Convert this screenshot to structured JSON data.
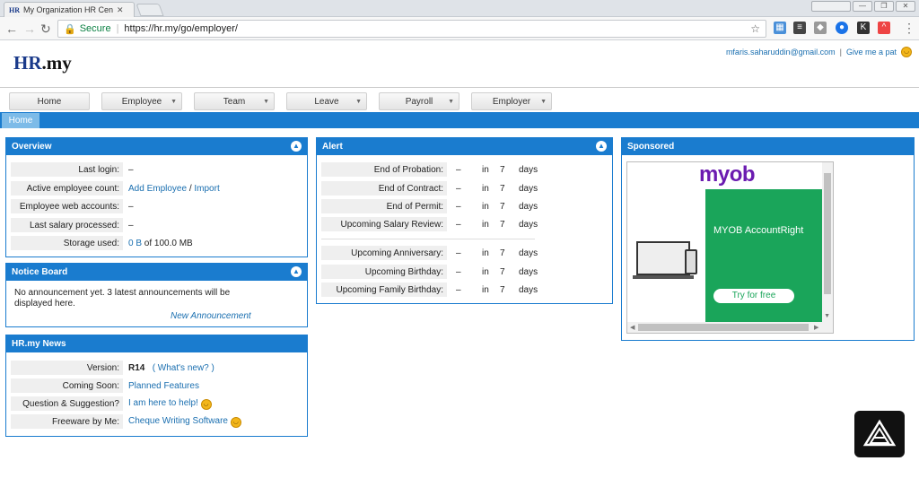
{
  "browser": {
    "tab_title": "My Organization HR Cen",
    "tab_favicon": "HR",
    "secure_label": "Secure",
    "url": "https://hr.my/go/employer/"
  },
  "header": {
    "logo_hr": "HR",
    "logo_my": ".my",
    "user_email": "mfaris.saharuddin@gmail.com",
    "pat_label": "Give me a pat"
  },
  "menu": [
    "Home",
    "Employee",
    "Team",
    "Leave",
    "Payroll",
    "Employer"
  ],
  "breadcrumb": "Home",
  "overview": {
    "title": "Overview",
    "rows": [
      {
        "label": "Last login:",
        "value": "–"
      },
      {
        "label": "Active employee count:",
        "link1": "Add Employee",
        "sep": "/",
        "link2": "Import"
      },
      {
        "label": "Employee web accounts:",
        "value": "–"
      },
      {
        "label": "Last salary processed:",
        "value": "–"
      },
      {
        "label": "Storage used:",
        "link1": "0 B",
        "rest": "of 100.0 MB"
      }
    ]
  },
  "notice": {
    "title": "Notice Board",
    "text": "No announcement yet. 3 latest announcements will be displayed here.",
    "link": "New Announcement"
  },
  "news": {
    "title": "HR.my News",
    "rows": [
      {
        "label": "Version:",
        "value": "R14",
        "link": "( What's new? )"
      },
      {
        "label": "Coming Soon:",
        "link": "Planned Features"
      },
      {
        "label": "Question & Suggestion?",
        "link": "I am here to help!"
      },
      {
        "label": "Freeware by Me:",
        "link": "Cheque Writing Software"
      }
    ]
  },
  "alert": {
    "title": "Alert",
    "rows": [
      {
        "label": "End of Probation:",
        "dash": "–",
        "in": "in",
        "num": "7",
        "unit": "days"
      },
      {
        "label": "End of Contract:",
        "dash": "–",
        "in": "in",
        "num": "7",
        "unit": "days"
      },
      {
        "label": "End of Permit:",
        "dash": "–",
        "in": "in",
        "num": "7",
        "unit": "days"
      },
      {
        "label": "Upcoming Salary Review:",
        "dash": "–",
        "in": "in",
        "num": "7",
        "unit": "days"
      },
      {
        "label": "Upcoming Anniversary:",
        "dash": "–",
        "in": "in",
        "num": "7",
        "unit": "days"
      },
      {
        "label": "Upcoming Birthday:",
        "dash": "–",
        "in": "in",
        "num": "7",
        "unit": "days"
      },
      {
        "label": "Upcoming Family Birthday:",
        "dash": "–",
        "in": "in",
        "num": "7",
        "unit": "days"
      }
    ]
  },
  "sponsored": {
    "title": "Sponsored",
    "brand": "myob",
    "product": "MYOB AccountRight",
    "cta": "Try for free"
  },
  "colors": {
    "accent": "#1a7ccf",
    "link": "#1a6fb0",
    "myob_purple": "#6b1bb0",
    "myob_green": "#1aa55a"
  }
}
